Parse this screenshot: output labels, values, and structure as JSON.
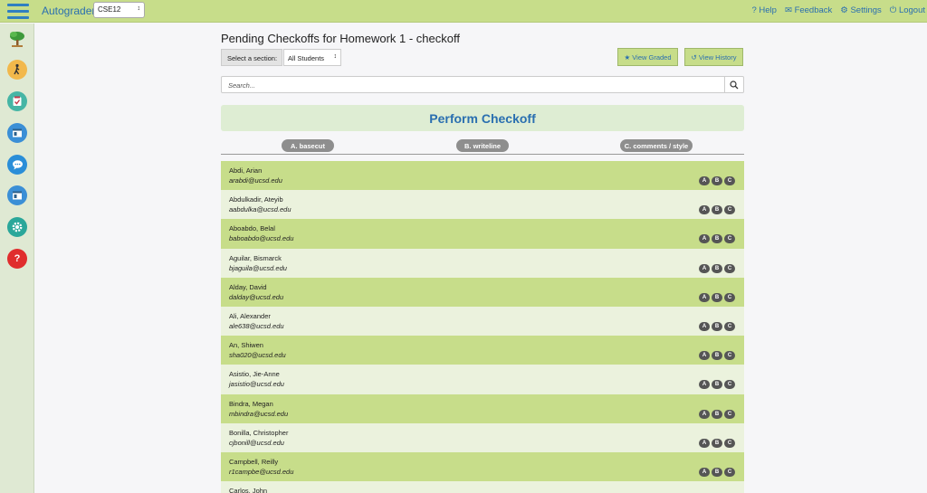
{
  "topbar": {
    "brand": "Autograder",
    "course": "CSE12",
    "links": {
      "help": "? Help",
      "feedback": "Feedback",
      "settings": "Settings",
      "logout": "Logout"
    }
  },
  "sidebar": {
    "icons": [
      "tree-icon",
      "person-walking-icon",
      "clipboard-check-icon",
      "window-icon",
      "chat-bubble-icon",
      "window-icon",
      "gear-icon",
      "question-icon"
    ]
  },
  "main": {
    "title": "Pending Checkoffs for Homework 1 - checkoff",
    "section_label": "Select a section:",
    "section_value": "All Students",
    "view_graded": "View Graded",
    "view_history": "View History",
    "search_placeholder": "Search...",
    "banner": "Perform Checkoff",
    "columns": [
      "A. basecut",
      "B. writeline",
      "C. comments / style"
    ],
    "badge_labels": [
      "A",
      "B",
      "C"
    ]
  },
  "students": [
    {
      "name": "Abdi, Arian",
      "email": "arabdi@ucsd.edu"
    },
    {
      "name": "Abdulkadir, Ateyib",
      "email": "aabdulka@ucsd.edu"
    },
    {
      "name": "Aboabdo, Belal",
      "email": "baboabdo@ucsd.edu"
    },
    {
      "name": "Aguilar, Bismarck",
      "email": "bjaguila@ucsd.edu"
    },
    {
      "name": "Alday, David",
      "email": "dalday@ucsd.edu"
    },
    {
      "name": "Ali, Alexander",
      "email": "ale638@ucsd.edu"
    },
    {
      "name": "An, Shiwen",
      "email": "sha020@ucsd.edu"
    },
    {
      "name": "Asistio, Jie-Anne",
      "email": "jasistio@ucsd.edu"
    },
    {
      "name": "Bindra, Megan",
      "email": "mbindra@ucsd.edu"
    },
    {
      "name": "Bonilla, Christopher",
      "email": "cjbonill@ucsd.edu"
    },
    {
      "name": "Campbell, Reilly",
      "email": "r1campbe@ucsd.edu"
    },
    {
      "name": "Carlos, John",
      "email": ""
    }
  ],
  "colors": {
    "accent": "#2a6fb0",
    "bar_green": "#c7dd8a",
    "row_light": "#ebf2dd",
    "badge": "#555555"
  }
}
